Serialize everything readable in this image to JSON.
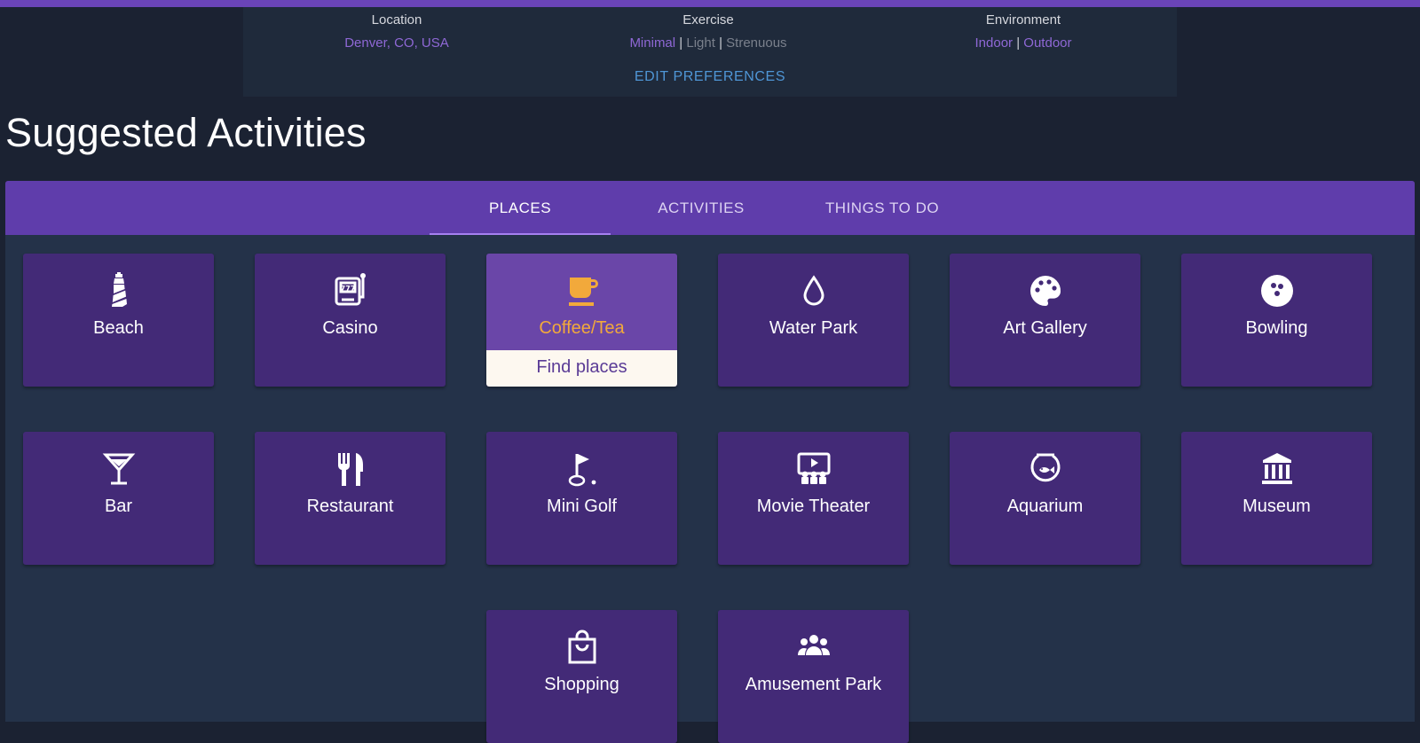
{
  "preferences": {
    "location": {
      "heading": "Location",
      "value": "Denver, CO, USA"
    },
    "exercise": {
      "heading": "Exercise",
      "options": [
        "Minimal",
        "Light",
        "Strenuous"
      ],
      "selected": "Minimal",
      "separator": "|"
    },
    "environment": {
      "heading": "Environment",
      "options": [
        "Indoor",
        "Outdoor"
      ],
      "selected": [
        "Indoor",
        "Outdoor"
      ],
      "separator": "|"
    },
    "edit_label": "EDIT PREFERENCES"
  },
  "page_title": "Suggested Activities",
  "tabs": [
    {
      "label": "PLACES",
      "active": true
    },
    {
      "label": "ACTIVITIES",
      "active": false
    },
    {
      "label": "THINGS TO DO",
      "active": false
    }
  ],
  "cards": [
    {
      "label": "Beach",
      "icon": "lighthouse-icon"
    },
    {
      "label": "Casino",
      "icon": "slot-machine-icon"
    },
    {
      "label": "Coffee/Tea",
      "icon": "coffee-cup-icon",
      "selected": true,
      "action": "Find places"
    },
    {
      "label": "Water Park",
      "icon": "water-drop-icon"
    },
    {
      "label": "Art Gallery",
      "icon": "palette-icon"
    },
    {
      "label": "Bowling",
      "icon": "bowling-ball-icon"
    },
    {
      "label": "Bar",
      "icon": "cocktail-glass-icon"
    },
    {
      "label": "Restaurant",
      "icon": "fork-knife-icon"
    },
    {
      "label": "Mini Golf",
      "icon": "golf-flag-icon"
    },
    {
      "label": "Movie Theater",
      "icon": "movie-screen-icon"
    },
    {
      "label": "Aquarium",
      "icon": "fishbowl-icon"
    },
    {
      "label": "Museum",
      "icon": "museum-building-icon"
    },
    {
      "label": "Shopping",
      "icon": "shopping-bag-icon"
    },
    {
      "label": "Amusement Park",
      "icon": "group-people-icon"
    }
  ],
  "colors": {
    "accent": "#5f3dab",
    "card": "#432a77",
    "selected_card": "#6a46a8",
    "selected_label": "#f2a93b",
    "link": "#4f96d6"
  }
}
